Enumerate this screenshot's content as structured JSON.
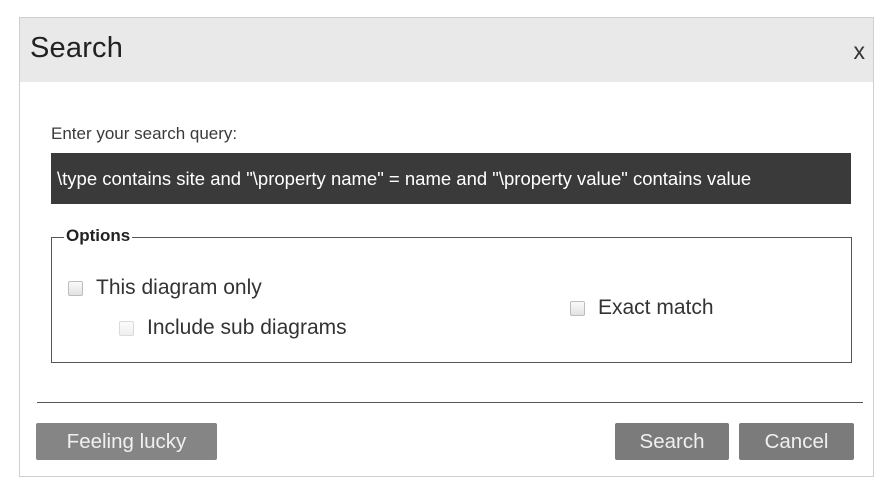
{
  "dialog": {
    "title": "Search",
    "close_label": "x"
  },
  "search": {
    "prompt": "Enter your search query:",
    "query": "\\type contains site and \"\\property name\" = name and \"\\property value\" contains value"
  },
  "options": {
    "legend": "Options",
    "this_diagram_only": {
      "label": "This diagram only",
      "checked": false
    },
    "include_sub_diagrams": {
      "label": "Include sub diagrams",
      "checked": false,
      "enabled": false
    },
    "exact_match": {
      "label": "Exact match",
      "checked": false
    }
  },
  "buttons": {
    "feeling_lucky": "Feeling lucky",
    "search": "Search",
    "cancel": "Cancel"
  }
}
